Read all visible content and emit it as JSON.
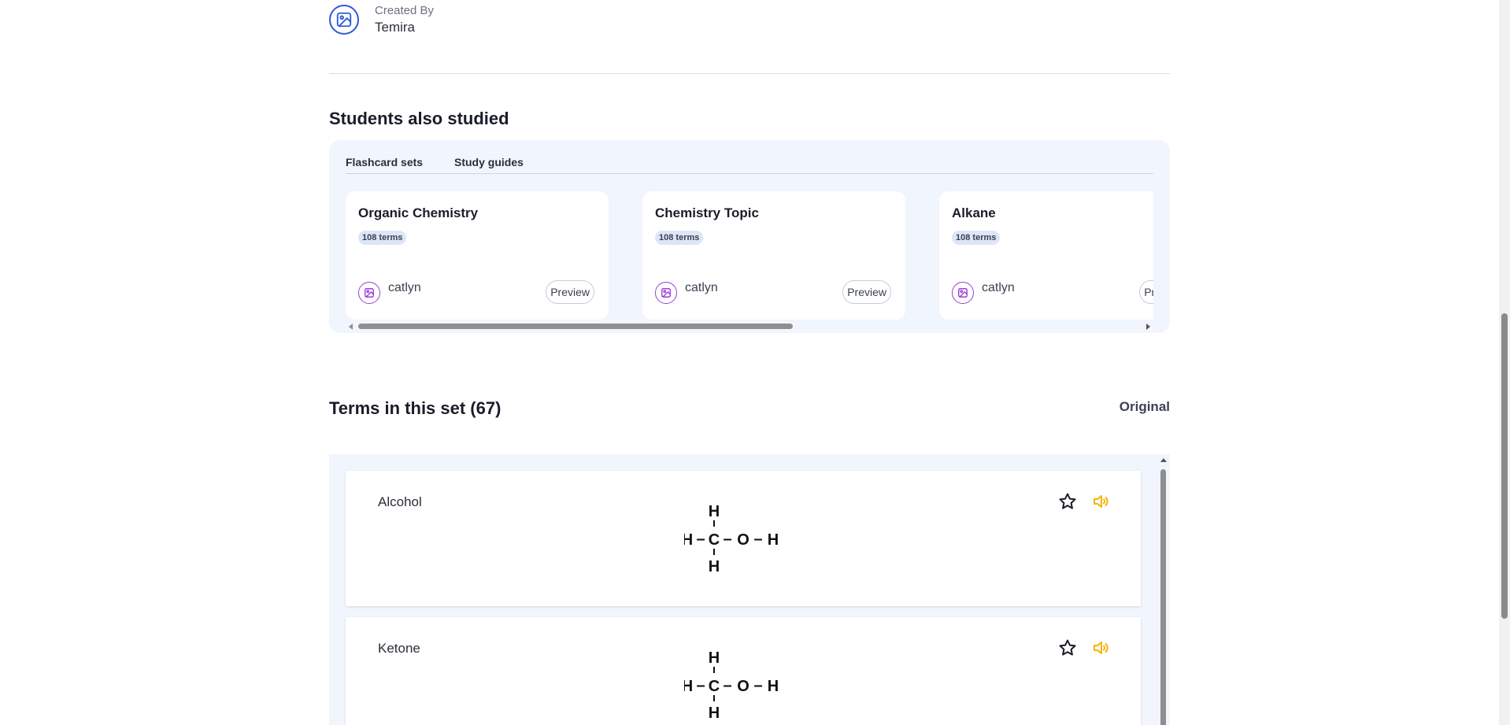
{
  "creator": {
    "label": "Created By",
    "name": "Temira"
  },
  "also_studied": {
    "title": "Students also studied",
    "tabs": [
      "Flashcard sets",
      "Study guides"
    ],
    "cards": [
      {
        "title": "Organic Chemistry",
        "terms": "108 terms",
        "author": "catlyn",
        "preview": "Preview"
      },
      {
        "title": "Chemistry Topic",
        "terms": "108 terms",
        "author": "catlyn",
        "preview": "Preview"
      },
      {
        "title": "Alkane",
        "terms": "108 terms",
        "author": "catlyn",
        "preview": "Preview"
      }
    ]
  },
  "terms_section": {
    "title": "Terms in this set (67)",
    "sort_label": "Original",
    "terms": [
      {
        "word": "Alcohol",
        "formula": {
          "top": "H",
          "bottom": "H",
          "left": "H",
          "center": "C",
          "right1": "O",
          "right2": "H",
          "dash": "–"
        }
      },
      {
        "word": "Ketone",
        "formula": {
          "top": "H",
          "bottom": "H",
          "left": "H",
          "center": "C",
          "right1": "O",
          "right2": "H",
          "dash": "–"
        }
      }
    ]
  },
  "colors": {
    "accent": "#2d5bd6",
    "avatar_purple": "#9b3fd6",
    "audio_icon": "#f5b400",
    "panel_bg": "#f1f5fd"
  },
  "icons": [
    "image-icon",
    "star-icon",
    "speaker-icon"
  ]
}
